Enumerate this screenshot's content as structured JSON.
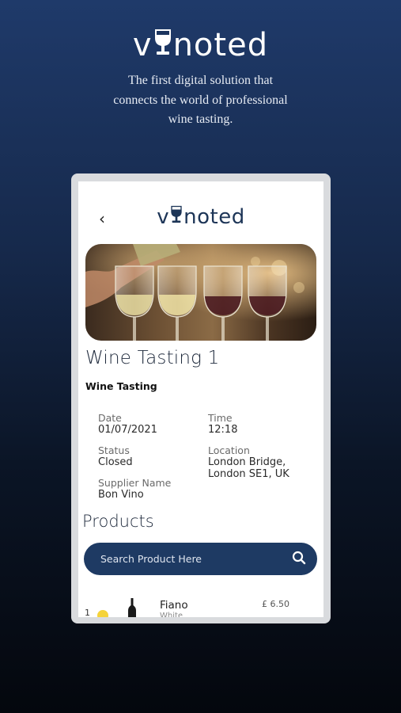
{
  "brand": {
    "pre": "v",
    "post": "noted"
  },
  "tagline": [
    "The first digital solution that",
    "connects the world of professional",
    "wine tasting."
  ],
  "app": {
    "back_glyph": "‹",
    "logo_pre": "v",
    "logo_post": "noted"
  },
  "event": {
    "title": "Wine Tasting 1",
    "subtitle": "Wine Tasting",
    "date_label": "Date",
    "date_value": "01/07/2021",
    "time_label": "Time",
    "time_value": "12:18",
    "status_label": "Status",
    "status_value": "Closed",
    "location_label": "Location",
    "location_line1": "London Bridge,",
    "location_line2": "London SE1, UK",
    "supplier_label": "Supplier Name",
    "supplier_value": "Bon Vino"
  },
  "products": {
    "heading": "Products",
    "search_placeholder": "Search Product Here",
    "items": [
      {
        "index": "1",
        "name": "Fiano",
        "type": "White",
        "price": "£ 6.50"
      }
    ]
  },
  "colors": {
    "brand_navy": "#1e3a63",
    "background_top": "#1f3a6a",
    "background_bottom": "#04070d",
    "dot_yellow": "#f5d33a"
  },
  "icons": {
    "glass": "wine-glass-icon",
    "back": "chevron-left-icon",
    "search": "search-icon",
    "bottle": "wine-bottle-icon"
  }
}
